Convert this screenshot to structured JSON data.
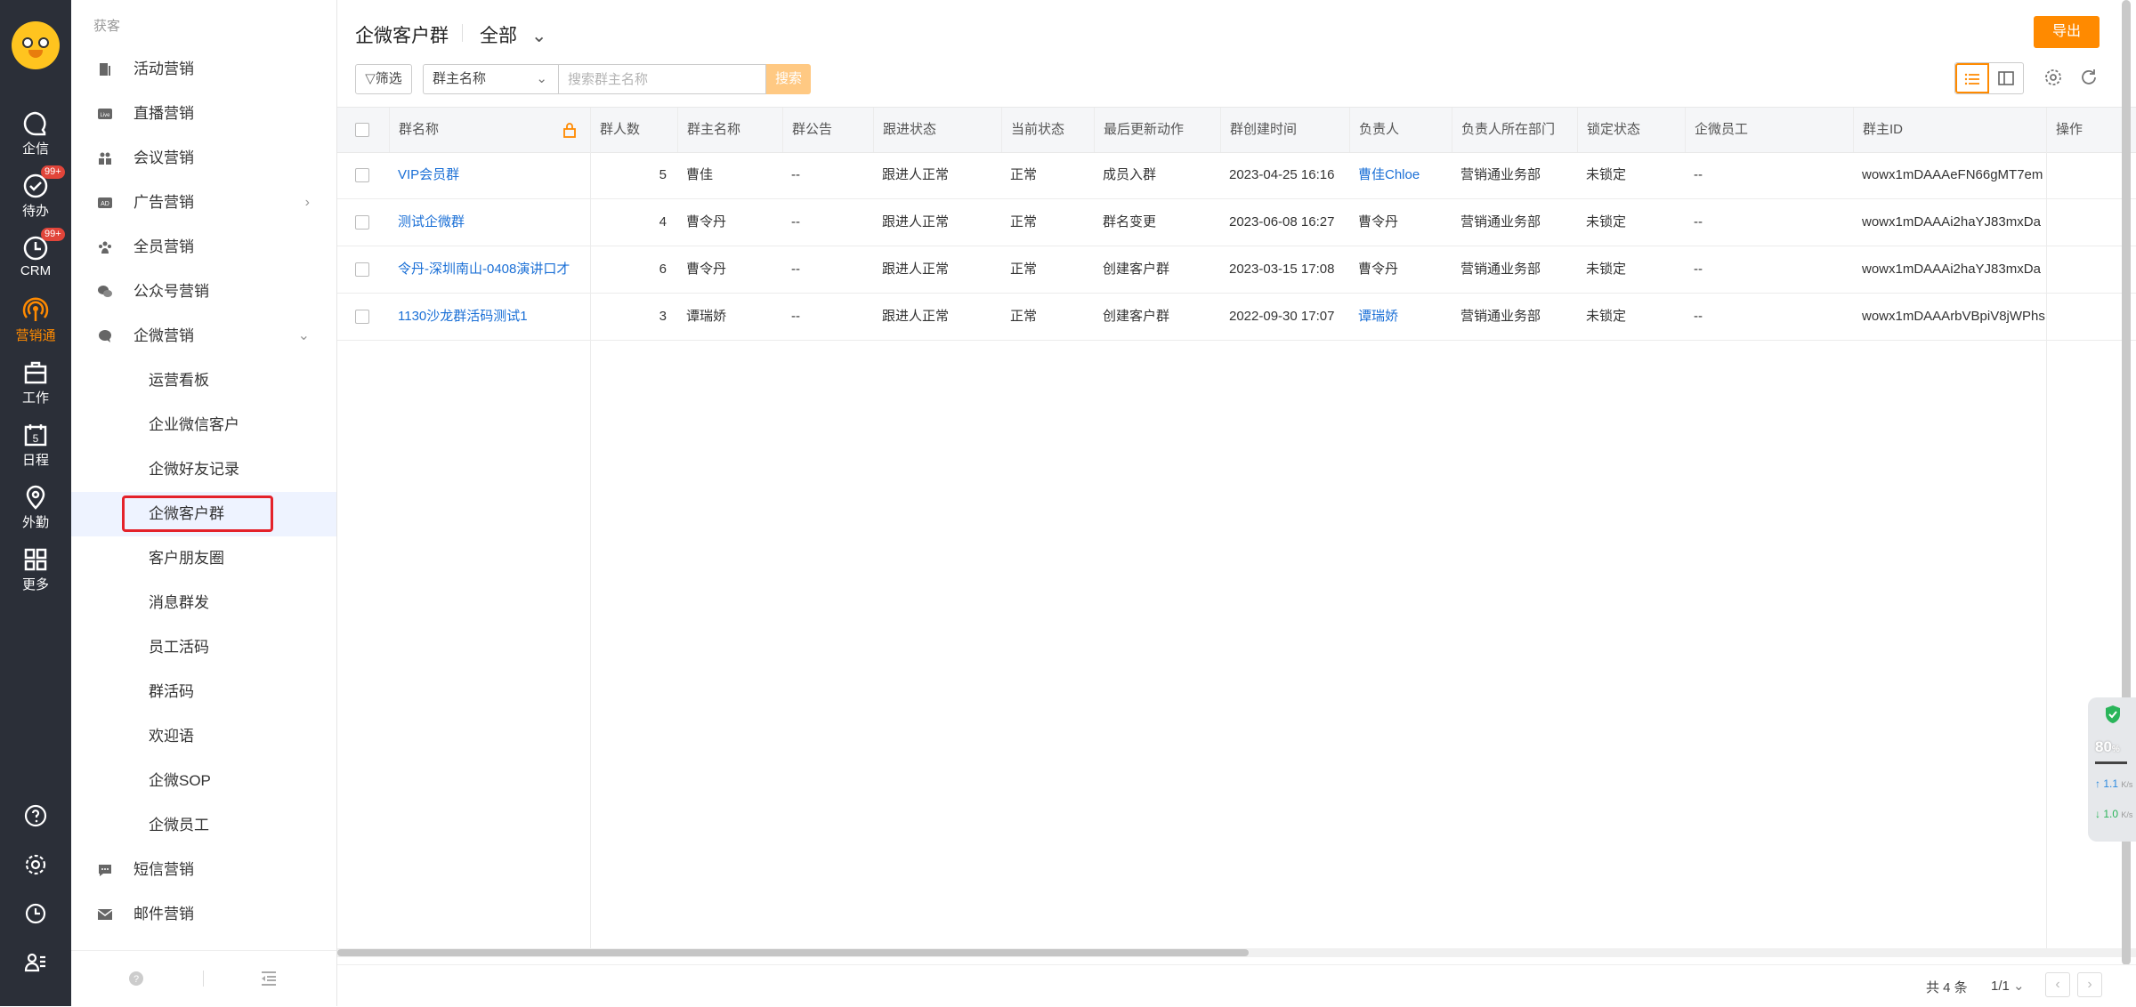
{
  "rail": {
    "items": [
      {
        "label": "企信",
        "icon": "chat-bubble-icon"
      },
      {
        "label": "待办",
        "icon": "check-circle-icon",
        "badge": "99+"
      },
      {
        "label": "CRM",
        "icon": "clock-icon",
        "badge": "99+"
      },
      {
        "label": "营销通",
        "icon": "broadcast-icon",
        "active": true
      },
      {
        "label": "工作",
        "icon": "briefcase-icon"
      },
      {
        "label": "日程",
        "icon": "calendar-icon",
        "day": "5"
      },
      {
        "label": "外勤",
        "icon": "location-pin-icon"
      },
      {
        "label": "更多",
        "icon": "grid-icon"
      }
    ]
  },
  "sidebar": {
    "section": "获客",
    "items": [
      {
        "label": "活动营销",
        "icon": "document-icon"
      },
      {
        "label": "直播营销",
        "icon": "live-icon"
      },
      {
        "label": "会议营销",
        "icon": "meeting-icon"
      },
      {
        "label": "广告营销",
        "icon": "ad-icon"
      },
      {
        "label": "全员营销",
        "icon": "people-icon"
      },
      {
        "label": "公众号营销",
        "icon": "wechat-icon"
      },
      {
        "label": "企微营销",
        "icon": "wecom-icon"
      }
    ],
    "subitems": [
      {
        "label": "运营看板"
      },
      {
        "label": "企业微信客户"
      },
      {
        "label": "企微好友记录"
      },
      {
        "label": "企微客户群",
        "active": true
      },
      {
        "label": "客户朋友圈"
      },
      {
        "label": "消息群发"
      },
      {
        "label": "员工活码"
      },
      {
        "label": "群活码"
      },
      {
        "label": "欢迎语"
      },
      {
        "label": "企微SOP"
      },
      {
        "label": "企微员工"
      }
    ],
    "items_bottom": [
      {
        "label": "短信营销",
        "icon": "sms-icon"
      },
      {
        "label": "邮件营销",
        "icon": "mail-icon"
      }
    ]
  },
  "header": {
    "title": "企微客户群",
    "scope": "全部",
    "export_label": "导出"
  },
  "toolbar": {
    "filter_label": "筛选",
    "search_field": "群主名称",
    "search_placeholder": "搜索群主名称",
    "search_button": "搜索"
  },
  "table": {
    "columns": [
      "群名称",
      "群人数",
      "群主名称",
      "群公告",
      "跟进状态",
      "当前状态",
      "最后更新动作",
      "群创建时间",
      "负责人",
      "负责人所在部门",
      "锁定状态",
      "企微员工",
      "群主ID",
      "操作"
    ],
    "rows": [
      {
        "name": "VIP会员群",
        "count": "5",
        "owner": "曹佳",
        "notice": "--",
        "follow": "跟进人正常",
        "status": "正常",
        "last_action": "成员入群",
        "created": "2023-04-25 16:16",
        "manager": "曹佳Chloe",
        "manager_link": true,
        "dept": "营销通业务部",
        "lock": "未锁定",
        "staff": "--",
        "owner_id": "wowx1mDAAAeFN66gMT7em"
      },
      {
        "name": "测试企微群",
        "count": "4",
        "owner": "曹令丹",
        "notice": "--",
        "follow": "跟进人正常",
        "status": "正常",
        "last_action": "群名变更",
        "created": "2023-06-08 16:27",
        "manager": "曹令丹",
        "manager_link": false,
        "dept": "营销通业务部",
        "lock": "未锁定",
        "staff": "--",
        "owner_id": "wowx1mDAAAi2haYJ83mxDa"
      },
      {
        "name": "令丹-深圳南山-0408演讲口才",
        "count": "6",
        "owner": "曹令丹",
        "notice": "--",
        "follow": "跟进人正常",
        "status": "正常",
        "last_action": "创建客户群",
        "created": "2023-03-15 17:08",
        "manager": "曹令丹",
        "manager_link": false,
        "dept": "营销通业务部",
        "lock": "未锁定",
        "staff": "--",
        "owner_id": "wowx1mDAAAi2haYJ83mxDa"
      },
      {
        "name": "1130沙龙群活码测试1",
        "count": "3",
        "owner": "谭瑞娇",
        "notice": "--",
        "follow": "跟进人正常",
        "status": "正常",
        "last_action": "创建客户群",
        "created": "2022-09-30 17:07",
        "manager": "谭瑞娇",
        "manager_link": true,
        "dept": "营销通业务部",
        "lock": "未锁定",
        "staff": "--",
        "owner_id": "wowx1mDAAArbVBpiV8jWPhs"
      }
    ]
  },
  "pagination": {
    "total": "共 4 条",
    "page": "1/1"
  },
  "net_widget": {
    "percent": "80",
    "percent_unit": "%",
    "up": "1.1",
    "down": "1.0",
    "unit": "K/s"
  },
  "colors": {
    "accent": "#ff8a00",
    "link": "#1a6fd6",
    "rail_bg": "#2b2f38",
    "highlight_box": "#e4222a"
  }
}
